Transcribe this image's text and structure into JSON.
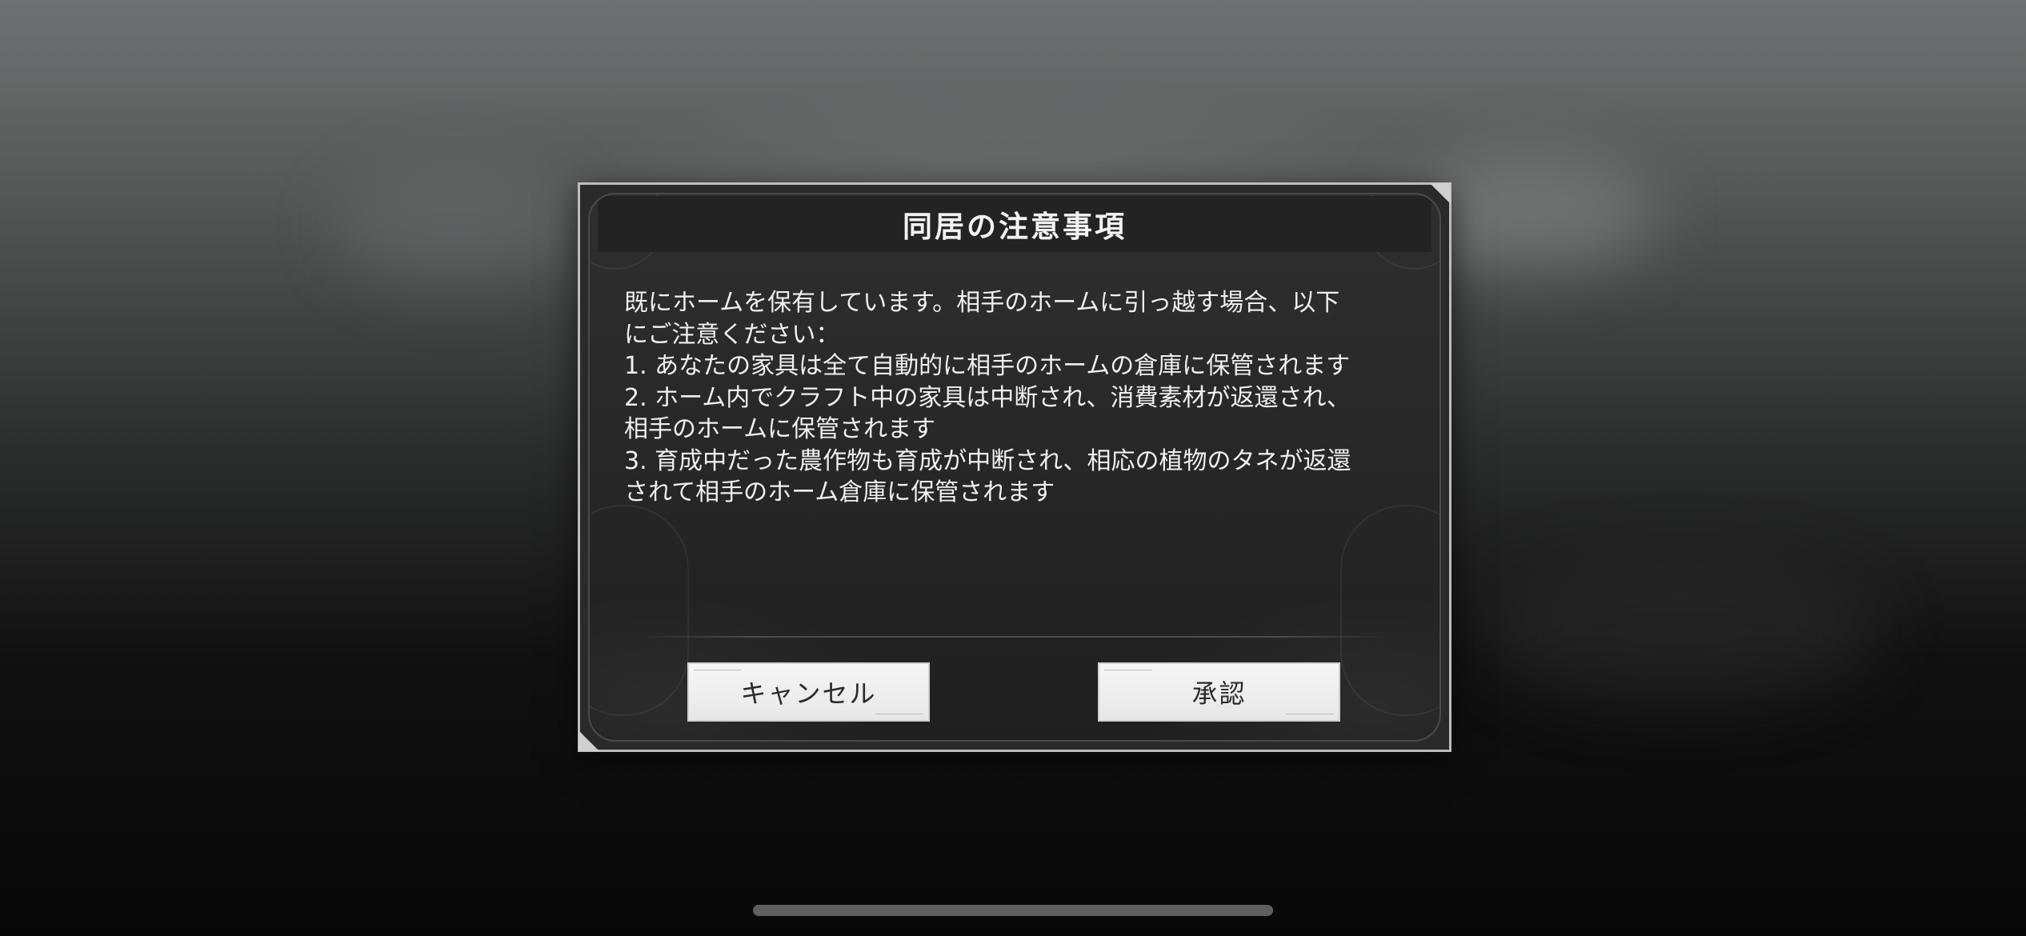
{
  "dialog": {
    "title": "同居の注意事項",
    "message_lines": [
      "既にホームを保有しています。相手のホームに引っ越す場合、以下",
      "にご注意ください：",
      "1. あなたの家具は全て自動的に相手のホームの倉庫に保管されます",
      "2. ホーム内でクラフト中の家具は中断され、消費素材が返還され、",
      "相手のホームに保管されます",
      "3. 育成中だった農作物も育成が中断され、相応の植物のタネが返還",
      "されて相手のホーム倉庫に保管されます"
    ],
    "buttons": {
      "cancel_label": "キャンセル",
      "confirm_label": "承認"
    }
  },
  "colors": {
    "dialog_background": "#2a2a2a",
    "dialog_border": "#bdbdbd",
    "button_background": "#f2f2f2",
    "text": "#f0f0f0"
  }
}
